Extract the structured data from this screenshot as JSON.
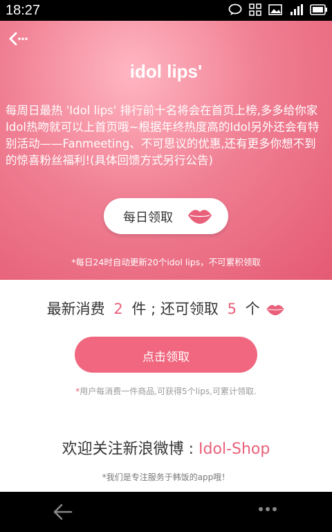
{
  "status": {
    "time": "18:27"
  },
  "header": {
    "title": "idol lips'"
  },
  "hero": {
    "description": "每周日最热 'Idol lips' 排行前十名将会在首页上榜,多多给你家Idol热吻就可以上首页哦~根据年终热度高的Idol另外还会有特别活动——Fanmeeting、不可思议的优惠,还有更多你想不到的惊喜粉丝福利!(具体回馈方式另行公告)",
    "daily_button": "每日领取",
    "note": "*每日24时自动更新20个idol lips，不可累积领取"
  },
  "consume": {
    "prefix": "最新消费",
    "count": "2",
    "middle": "件 ; 还可领取",
    "remaining": "5",
    "suffix": "个"
  },
  "claim_button": "点击领取",
  "claim_note_star": "*",
  "claim_note": "用户每消费一件商品,可获得5个lips,可累计领取.",
  "follow": {
    "prefix": "欢迎关注新浪微博 : ",
    "shop": "Idol-Shop"
  },
  "footer_note": "*我们是专注服务于韩饭的app哦！",
  "colors": {
    "accent": "#e9607a",
    "button": "#f0677f"
  },
  "icons": [
    "back-arrow-icon",
    "lips-icon",
    "nav-back-icon",
    "more-icon"
  ]
}
